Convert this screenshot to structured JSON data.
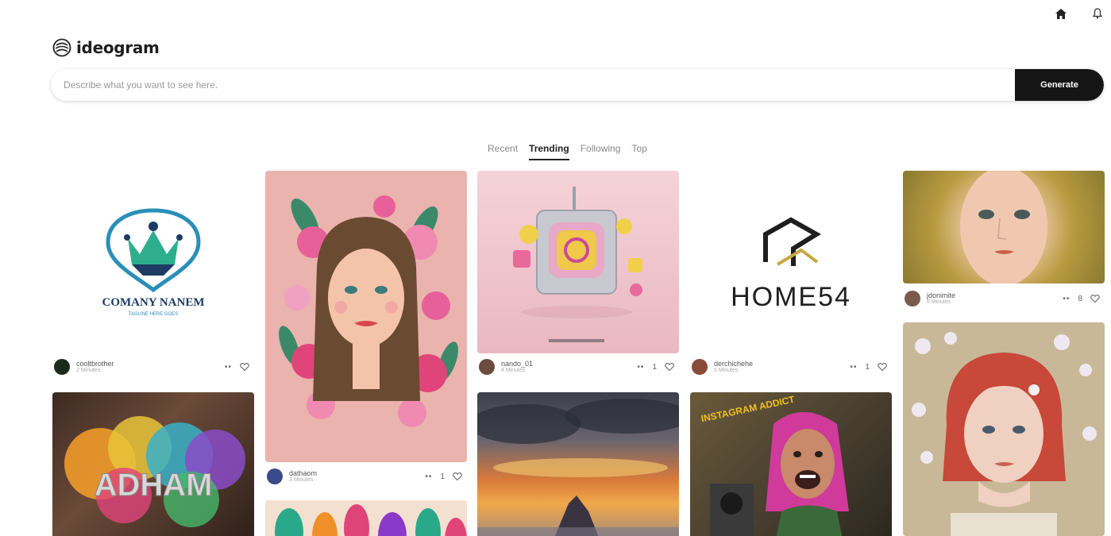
{
  "app": {
    "name": "ideogram"
  },
  "search": {
    "placeholder": "Describe what you want to see here.",
    "button_label": "Generate"
  },
  "tabs": [
    {
      "label": "Recent",
      "active": false
    },
    {
      "label": "Trending",
      "active": true
    },
    {
      "label": "Following",
      "active": false
    },
    {
      "label": "Top",
      "active": false
    }
  ],
  "cards": [
    {
      "image": "company-logo-crown",
      "image_text": [
        "COMANY NANEM",
        "TAGLINE HERE GOES"
      ],
      "user": "cooltbrother",
      "sub": "2 Minutes",
      "likes": "",
      "avatar_color": "#1b2a1a"
    },
    {
      "image": "adham-color-splash",
      "image_text": [
        "ADHAM"
      ],
      "user": "",
      "sub": "",
      "likes": "",
      "avatar_color": "#888"
    },
    {
      "image": "girl-with-flowers-portrait",
      "image_text": [],
      "user": "dathaom",
      "sub": "3 Minutes",
      "likes": "1",
      "avatar_color": "#3b4a8a"
    },
    {
      "image": "colorful-feathers",
      "image_text": [],
      "user": "",
      "sub": "",
      "likes": "",
      "avatar_color": "#888"
    },
    {
      "image": "3d-instagram-icon",
      "image_text": [],
      "user": "nando_01",
      "sub": "4 Minutes",
      "likes": "1",
      "avatar_color": "#6b4d3d"
    },
    {
      "image": "sunset-clouds-mountain",
      "image_text": [],
      "user": "",
      "sub": "",
      "likes": "",
      "avatar_color": "#888"
    },
    {
      "image": "home-54-logo",
      "image_text": [
        "HOME54"
      ],
      "user": "derchichehe",
      "sub": "5 Minutes",
      "likes": "1",
      "avatar_color": "#8a4a3a"
    },
    {
      "image": "instagram-addict-woman",
      "image_text": [
        "INSTAGRAM ADDICT"
      ],
      "user": "",
      "sub": "",
      "likes": "",
      "avatar_color": "#888"
    },
    {
      "image": "golden-glitter-face",
      "image_text": [],
      "user": "jdonimite",
      "sub": "6 Minutes",
      "likes": "8",
      "avatar_color": "#7a5a4a"
    },
    {
      "image": "red-bob-woman-cherry-blossom",
      "image_text": [],
      "user": "",
      "sub": "",
      "likes": "",
      "avatar_color": "#888"
    }
  ],
  "icons": {
    "home": "home-icon",
    "bell": "bell-icon",
    "heart": "heart-icon",
    "more": "more-icon"
  }
}
